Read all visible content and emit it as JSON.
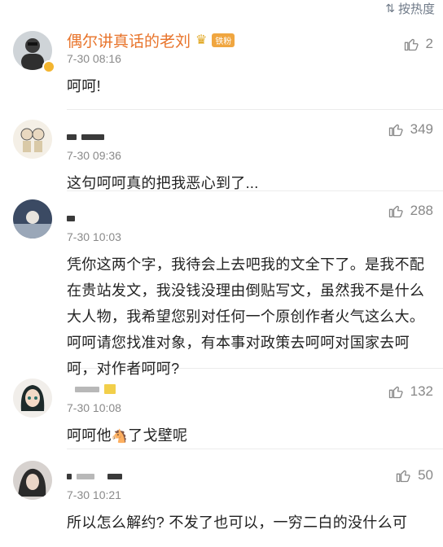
{
  "header": {
    "sort_label": "按热度",
    "sort_icon": "sort-arrows-icon"
  },
  "comments": [
    {
      "username": "偶尔讲真话的老刘",
      "fan_badge": "铁粉",
      "time": "7-30 08:16",
      "likes": "2",
      "text": "呵呵!"
    },
    {
      "username": "",
      "time": "7-30 09:36",
      "likes": "349",
      "text": "这句呵呵真的把我恶心到了..."
    },
    {
      "username": "",
      "time": "7-30 10:03",
      "likes": "288",
      "text": "凭你这两个字，我待会上去吧我的文全下了。是我不配在贵站发文，我没钱没理由倒贴写文，虽然我不是什么大人物，我希望您别对任何一个原创作者火气这么大。呵呵请您找准对象，有本事对政策去呵呵对国家去呵呵，对作者呵呵?"
    },
    {
      "username": "",
      "time": "7-30 10:08",
      "likes": "132",
      "text_a": "呵呵他",
      "text_b": "了戈壁呢"
    },
    {
      "username": "",
      "time": "7-30 10:21",
      "likes": "50",
      "text": "所以怎么解约? 不发了也可以，一穷二白的没什么可"
    }
  ]
}
